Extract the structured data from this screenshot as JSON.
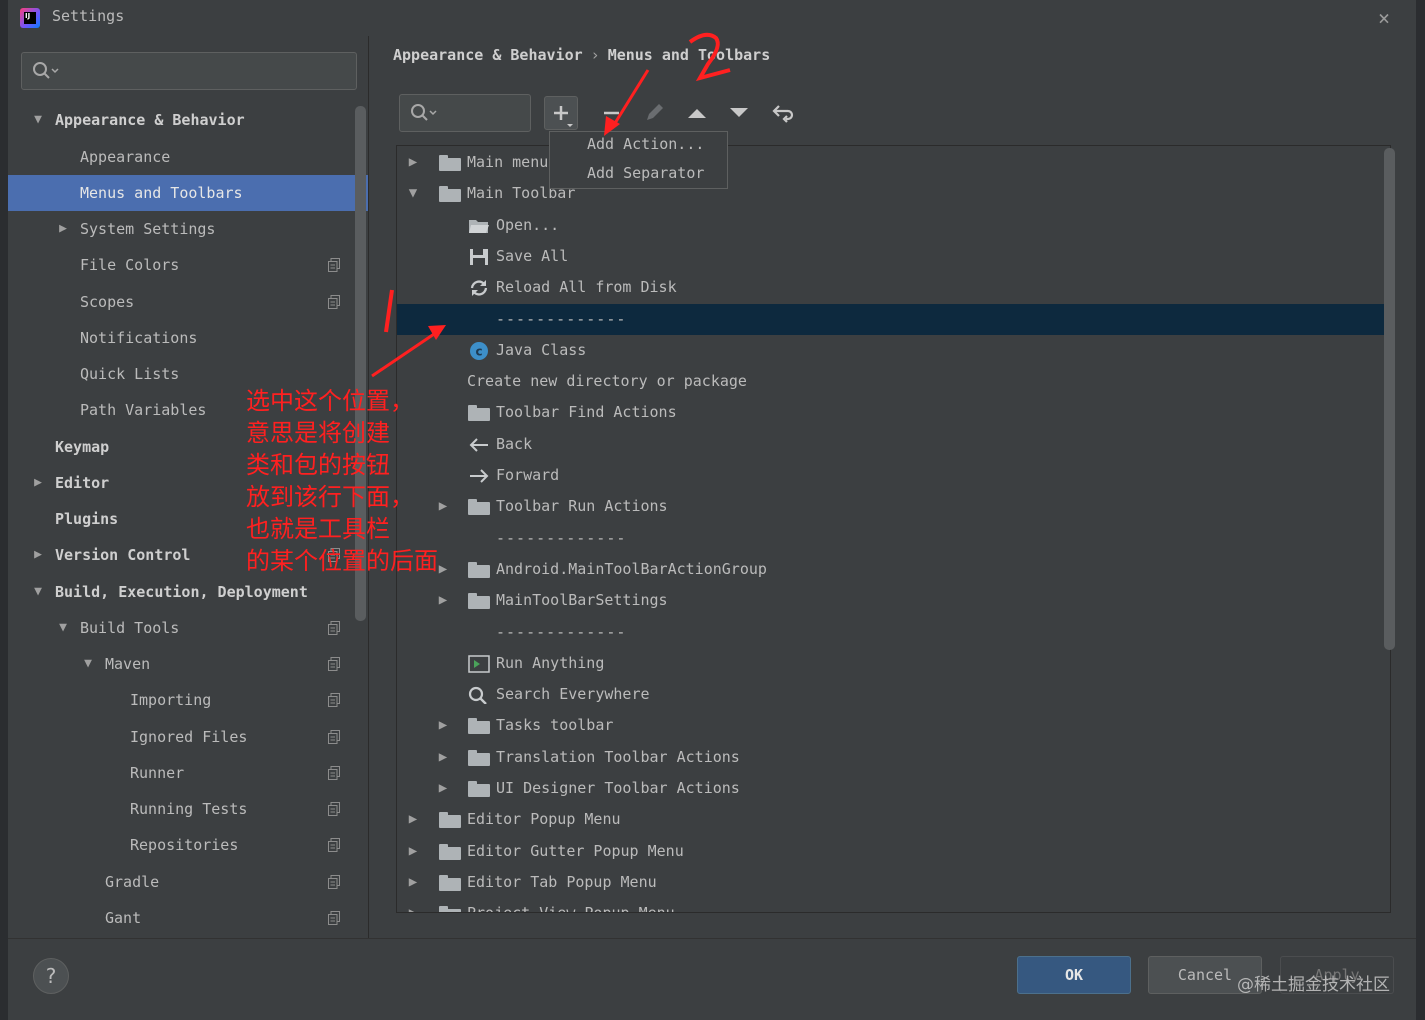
{
  "window": {
    "title": "Settings",
    "close_glyph": "×"
  },
  "left": {
    "search_placeholder": "",
    "items": [
      {
        "label": "Appearance & Behavior",
        "arrow": "▼",
        "bold": true
      },
      {
        "label": "Appearance"
      },
      {
        "label": "Menus and Toolbars",
        "selected": true
      },
      {
        "label": "System Settings",
        "arrow": "▶"
      },
      {
        "label": "File Colors",
        "copy_icon": true
      },
      {
        "label": "Scopes",
        "copy_icon": true
      },
      {
        "label": "Notifications"
      },
      {
        "label": "Quick Lists"
      },
      {
        "label": "Path Variables"
      },
      {
        "label": "Keymap",
        "bold": true
      },
      {
        "label": "Editor",
        "arrow": "▶",
        "bold": true
      },
      {
        "label": "Plugins",
        "bold": true
      },
      {
        "label": "Version Control",
        "arrow": "▶",
        "bold": true,
        "copy_icon": true
      },
      {
        "label": "Build, Execution, Deployment",
        "arrow": "▼",
        "bold": true
      },
      {
        "label": "Build Tools",
        "arrow": "▼",
        "copy_icon": true
      },
      {
        "label": "Maven",
        "arrow": "▼",
        "copy_icon": true
      },
      {
        "label": "Importing",
        "copy_icon": true
      },
      {
        "label": "Ignored Files",
        "copy_icon": true
      },
      {
        "label": "Runner",
        "copy_icon": true
      },
      {
        "label": "Running Tests",
        "copy_icon": true
      },
      {
        "label": "Repositories",
        "copy_icon": true
      },
      {
        "label": "Gradle",
        "copy_icon": true
      },
      {
        "label": "Gant",
        "copy_icon": true
      }
    ]
  },
  "breadcrumb": {
    "parent": "Appearance & Behavior",
    "separator": "›",
    "current": "Menus and Toolbars"
  },
  "toolbar": {
    "search_placeholder": "",
    "buttons": [
      "plus-icon",
      "minus-icon",
      "edit-icon",
      "move-up-icon",
      "move-down-icon",
      "restore-icon"
    ]
  },
  "popup": {
    "add_action": "Add Action...",
    "add_separator": "Add Separator"
  },
  "tree": [
    {
      "label": "Main menu",
      "arrow": "▶",
      "icon": "folder"
    },
    {
      "label": "Main Toolbar",
      "arrow": "▼",
      "icon": "folder"
    },
    {
      "label": "Open...",
      "icon": "open-folder"
    },
    {
      "label": "Save All",
      "icon": "save"
    },
    {
      "label": "Reload All from Disk",
      "icon": "reload"
    },
    {
      "label": "-------------",
      "separator": true,
      "selected": true
    },
    {
      "label": "Java Class",
      "icon": "java-class"
    },
    {
      "label": "Create new directory or package"
    },
    {
      "label": "Toolbar Find Actions",
      "icon": "folder"
    },
    {
      "label": "Back",
      "icon": "back-arrow"
    },
    {
      "label": "Forward",
      "icon": "forward-arrow"
    },
    {
      "label": "Toolbar Run Actions",
      "arrow": "▶",
      "icon": "folder"
    },
    {
      "label": "-------------",
      "separator": true
    },
    {
      "label": "Android.MainToolBarActionGroup",
      "arrow": "▶",
      "icon": "folder"
    },
    {
      "label": "MainToolBarSettings",
      "arrow": "▶",
      "icon": "folder"
    },
    {
      "label": "-------------",
      "separator": true
    },
    {
      "label": "Run Anything",
      "icon": "run-anything"
    },
    {
      "label": "Search Everywhere",
      "icon": "search"
    },
    {
      "label": "Tasks toolbar",
      "arrow": "▶",
      "icon": "folder"
    },
    {
      "label": "Translation Toolbar Actions",
      "arrow": "▶",
      "icon": "folder"
    },
    {
      "label": "UI Designer Toolbar Actions",
      "arrow": "▶",
      "icon": "folder"
    },
    {
      "label": "Editor Popup Menu",
      "arrow": "▶",
      "icon": "folder",
      "top_level": true
    },
    {
      "label": "Editor Gutter Popup Menu",
      "arrow": "▶",
      "icon": "folder",
      "top_level": true
    },
    {
      "label": "Editor Tab Popup Menu",
      "arrow": "▶",
      "icon": "folder",
      "top_level": true
    },
    {
      "label": "Project View Popup Menu",
      "arrow": "▶",
      "icon": "folder",
      "top_level": true
    }
  ],
  "annotation": {
    "lines": [
      "选中这个位置，",
      "意思是将创建",
      "类和包的按钮",
      "放到该行下面，",
      "也就是工具栏",
      "的某个位置的后面"
    ],
    "number_1": "1",
    "number_2": "2",
    "color": "#ff2020"
  },
  "buttons": {
    "help": "?",
    "ok": "OK",
    "cancel": "Cancel",
    "apply": "Apply"
  },
  "watermark": "@稀土掘金技术社区",
  "colors": {
    "selection_left": "#4b6eaf",
    "selection_tree": "#0d293e",
    "ok_button": "#365880",
    "background": "#3c3f41"
  }
}
